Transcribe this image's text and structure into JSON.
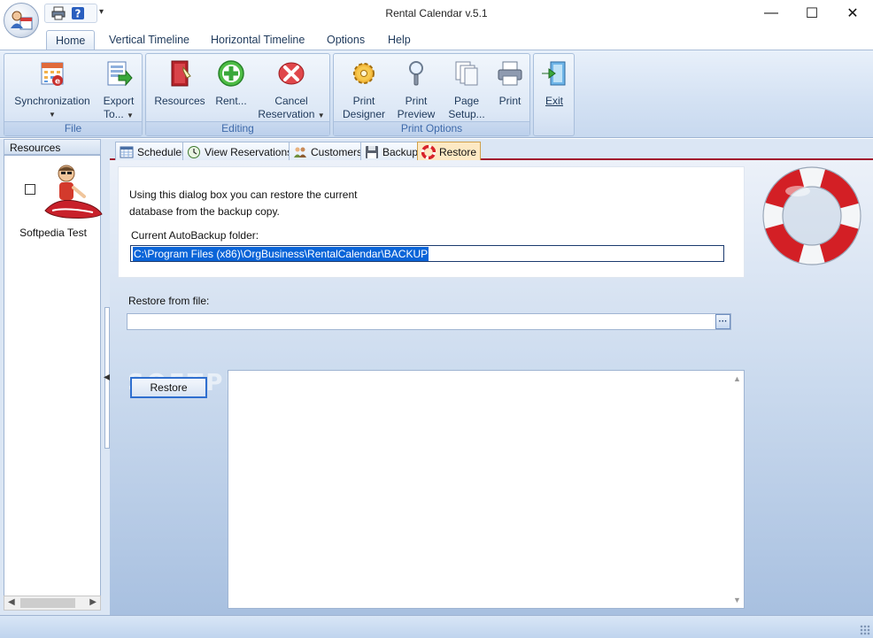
{
  "window": {
    "title": "Rental Calendar v.5.1",
    "controls": {
      "minimize": "—",
      "maximize": "☐",
      "close": "✕"
    }
  },
  "qat": {
    "print_icon": "printer-icon",
    "help_icon": "help-icon",
    "customize_arrow": "▾"
  },
  "ribbon_tabs": [
    "Home",
    "Vertical Timeline",
    "Horizontal Timeline",
    "Options",
    "Help"
  ],
  "ribbon": {
    "file": {
      "label": "File",
      "synchronization": "Synchronization",
      "export_line1": "Export",
      "export_line2": "To..."
    },
    "editing": {
      "label": "Editing",
      "resources": "Resources",
      "rent": "Rent...",
      "cancel_line1": "Cancel",
      "cancel_line2": "Reservation"
    },
    "print_options": {
      "label": "Print Options",
      "print_designer_line1": "Print",
      "print_designer_line2": "Designer",
      "print_preview_line1": "Print",
      "print_preview_line2": "Preview",
      "page_setup_line1": "Page",
      "page_setup_line2": "Setup...",
      "print": "Print"
    },
    "exit": {
      "label": "Exit"
    }
  },
  "resources_pane": {
    "header": "Resources",
    "items": [
      {
        "name": "Softpedia Test"
      }
    ]
  },
  "doc_tabs": [
    {
      "label": "Scheduler"
    },
    {
      "label": "View Reservations"
    },
    {
      "label": "Customers"
    },
    {
      "label": "Backup"
    },
    {
      "label": "Restore"
    }
  ],
  "restore_page": {
    "info_line1": "Using this dialog box you can restore the current",
    "info_line2": "database from the backup copy.",
    "autobackup_label": "Current AutoBackup folder:",
    "autobackup_path": "C:\\Program Files (x86)\\OrgBusiness\\RentalCalendar\\BACKUP",
    "restore_from_label": "Restore from file:",
    "restore_from_value": "",
    "browse_label": "···",
    "restore_button": "Restore",
    "watermark": "SOFTPEDIA"
  },
  "colors": {
    "accent_tab": "#fde9c4",
    "doc_tab_underline": "#a3122d",
    "ribbon_text": "#1e395b",
    "group_label": "#3e6aaa",
    "selection": "#0a64d8"
  }
}
